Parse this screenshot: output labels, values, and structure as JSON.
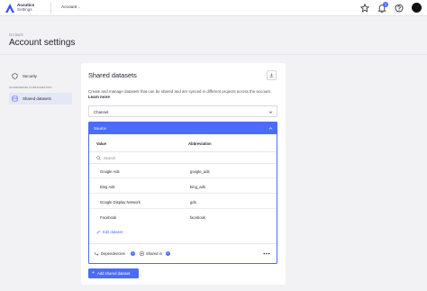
{
  "header": {
    "brand_line1": "Accutics",
    "brand_line2": "Settings",
    "breadcrumb": "Account",
    "notification_count": "2"
  },
  "page": {
    "go_back": "Go back",
    "title": "Account settings"
  },
  "sidebar": {
    "security_label": "Security",
    "section_label": "STANDARDIZE CONFIGURATION",
    "shared_label": "Shared datasets"
  },
  "panel": {
    "title": "Shared datasets",
    "description": "Create and manage datasets that can be shared and are synced in different projects across the account.",
    "learn_more": "Learn more",
    "channel_label": "Channel",
    "source_label": "Source",
    "columns": {
      "value": "Value",
      "abbreviation": "Abbreviation"
    },
    "search_placeholder": "Search",
    "rows": [
      {
        "value": "Google Ads",
        "abbreviation": "google_ads"
      },
      {
        "value": "Bing Ads",
        "abbreviation": "bing_ads"
      },
      {
        "value": "Google Display Network",
        "abbreviation": "gdn"
      },
      {
        "value": "Facebook",
        "abbreviation": "facebook"
      }
    ],
    "edit_label": "Edit dataset",
    "dependencies_label": "Dependencies",
    "dependencies_count": "1",
    "shared_in_label": "Shared in",
    "shared_in_count": "0",
    "add_label": "Add shared dataset"
  },
  "colors": {
    "accent": "#4b6bfb",
    "selected_bg": "#e4e7f6"
  }
}
